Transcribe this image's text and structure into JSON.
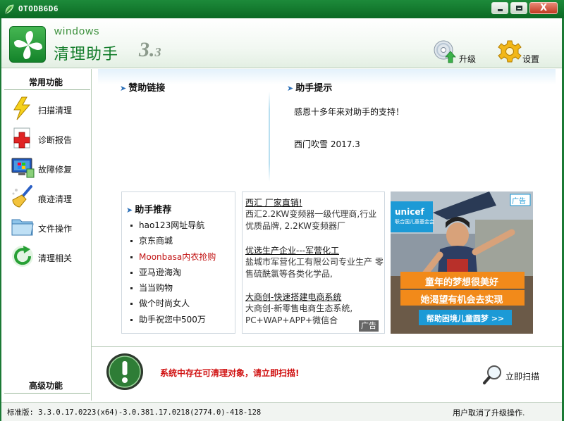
{
  "window": {
    "title": "OTODB6D6",
    "minimize_icon": "minimize-icon",
    "maximize_icon": "maximize-icon",
    "close_icon": "close-icon",
    "close_glyph": "X"
  },
  "header": {
    "brand_sub": "windows",
    "brand_name": "清理助手",
    "brand_version": "3.",
    "brand_version_sub": "3",
    "upgrade_label": "升级",
    "settings_label": "设置",
    "accent_color": "#127c2a"
  },
  "sidebar": {
    "title_top": "常用功能",
    "title_bottom": "高级功能",
    "items": [
      {
        "label": "扫描清理",
        "icon": "lightning-icon"
      },
      {
        "label": "诊断报告",
        "icon": "medical-cross-icon"
      },
      {
        "label": "故障修复",
        "icon": "repair-screen-icon"
      },
      {
        "label": "痕迹清理",
        "icon": "broom-icon"
      },
      {
        "label": "文件操作",
        "icon": "folder-icon"
      },
      {
        "label": "清理相关",
        "icon": "refresh-icon"
      }
    ]
  },
  "sponsor": {
    "heading": "赞助链接"
  },
  "tips": {
    "heading": "助手提示",
    "line1": "感恩十多年来对助手的支持！",
    "line2": "西门吹雪  2017.3"
  },
  "recommend": {
    "heading": "助手推荐",
    "items": [
      "hao123网址导航",
      "京东商城",
      "Moonbasa内衣抢购",
      "亚马逊海淘",
      "当当购物",
      "做个时尚女人",
      "助手祝您中500万"
    ]
  },
  "ads": {
    "items": [
      {
        "title": "西汇 厂家直销!",
        "desc": "西汇2.2KW变频器一级代理商,行业优质品牌, 2.2KW变频器厂"
      },
      {
        "title": "优选生产企业---军营化工",
        "desc": "盐城市军营化工有限公司专业生产 零售硫酰氯等各类化学品,"
      },
      {
        "title": "大商创-快速搭建电商系统",
        "desc": "大商创-新零售电商生态系统, PC+WAP+APP+微信合"
      }
    ],
    "tag": "广告"
  },
  "image_ad": {
    "brand": "unicef",
    "brand_sub": "联合国儿童基金会",
    "tag": "广告",
    "banner1": "童年的梦想很美好",
    "banner2": "她渴望有机会去实现",
    "cta": "帮助困境儿童圆梦 >>"
  },
  "alert": {
    "icon": "exclamation-icon",
    "text": "系统中存在可清理对象，请立即扫描!",
    "scan_label": "立即扫描",
    "scan_icon": "magnifier-icon",
    "color": "#d01010"
  },
  "status": {
    "version": "标准版: 3.3.0.17.0223(x64)-3.0.381.17.0218(2774.0)-418-128",
    "message": "用户取消了升级操作."
  }
}
